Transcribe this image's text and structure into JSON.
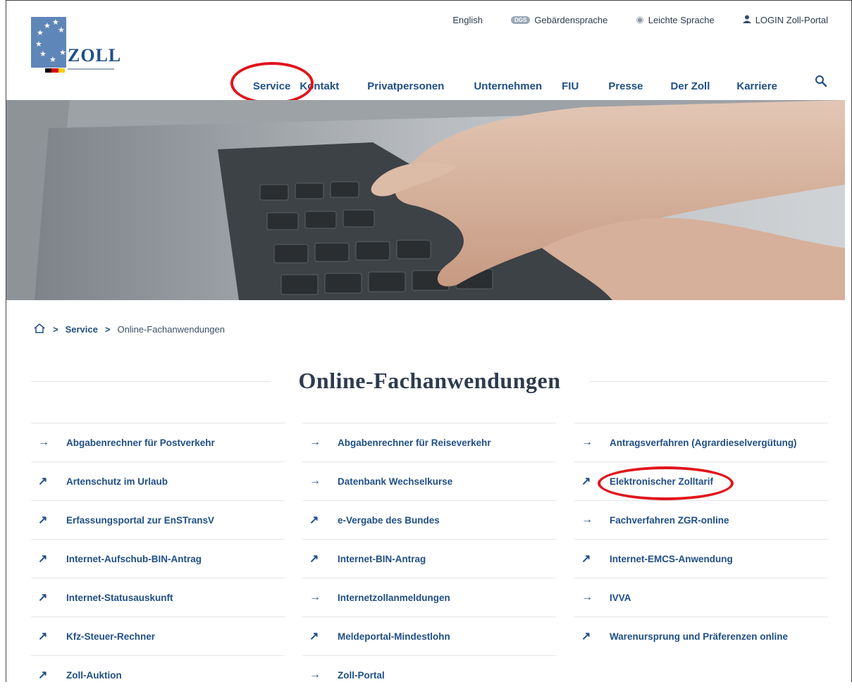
{
  "header": {
    "logo_text": "ZOLL",
    "top_links": [
      {
        "label": "English",
        "icon": ""
      },
      {
        "label": "Gebärdensprache",
        "icon": "sign-language-icon",
        "icon_text": "DGS"
      },
      {
        "label": "Leichte Sprache",
        "icon": "easy-language-icon"
      },
      {
        "label": "LOGIN Zoll-Portal",
        "icon": "user-icon"
      }
    ],
    "nav": [
      "Service",
      "Kontakt",
      "Privatpersonen",
      "Unternehmen",
      "FIU",
      "Presse",
      "Der Zoll",
      "Karriere"
    ],
    "highlight_color": "#e0151c",
    "accent_color": "#1f4f86"
  },
  "breadcrumb": {
    "items": [
      "Service",
      "Online-Fachanwendungen"
    ]
  },
  "page": {
    "title": "Online-Fachanwendungen"
  },
  "links": {
    "col1": [
      {
        "label": "Abgabenrechner für Postverkehr",
        "icon": "arrow-right-icon"
      },
      {
        "label": "Artenschutz im Urlaub",
        "icon": "arrow-external-icon"
      },
      {
        "label": "Erfassungsportal zur EnSTransV",
        "icon": "arrow-external-icon"
      },
      {
        "label": "Internet-Aufschub-BIN-Antrag",
        "icon": "arrow-external-icon"
      },
      {
        "label": "Internet-Statusauskunft",
        "icon": "arrow-external-icon"
      },
      {
        "label": "Kfz-Steuer-Rechner",
        "icon": "arrow-external-icon"
      },
      {
        "label": "Zoll-Auktion",
        "icon": "arrow-external-icon"
      }
    ],
    "col2": [
      {
        "label": "Abgabenrechner für Reiseverkehr",
        "icon": "arrow-right-icon"
      },
      {
        "label": "Datenbank Wechselkurse",
        "icon": "arrow-right-icon"
      },
      {
        "label": "e-Vergabe des Bundes",
        "icon": "arrow-external-icon"
      },
      {
        "label": "Internet-BIN-Antrag",
        "icon": "arrow-external-icon"
      },
      {
        "label": "Internetzollanmeldungen",
        "icon": "arrow-right-icon"
      },
      {
        "label": "Meldeportal-Mindestlohn",
        "icon": "arrow-external-icon"
      },
      {
        "label": "Zoll-Portal",
        "icon": "arrow-right-icon"
      }
    ],
    "col3": [
      {
        "label": "Antragsverfahren (Agrardieselvergütung)",
        "icon": "arrow-right-icon"
      },
      {
        "label": "Elektronischer Zolltarif",
        "icon": "arrow-external-icon"
      },
      {
        "label": "Fachverfahren ZGR-online",
        "icon": "arrow-right-icon"
      },
      {
        "label": "Internet-EMCS-Anwendung",
        "icon": "arrow-external-icon"
      },
      {
        "label": "IVVA",
        "icon": "arrow-right-icon"
      },
      {
        "label": "Warenursprung und Präferenzen online",
        "icon": "arrow-external-icon"
      }
    ]
  }
}
